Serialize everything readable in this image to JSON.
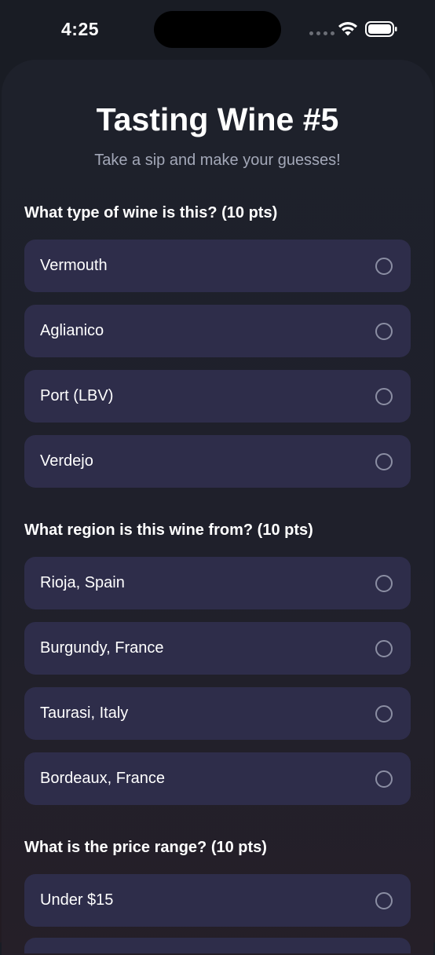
{
  "status": {
    "time": "4:25"
  },
  "header": {
    "title": "Tasting Wine #5",
    "subtitle": "Take a sip and make your guesses!"
  },
  "questions": [
    {
      "text": "What type of wine is this? (10 pts)",
      "options": [
        "Vermouth",
        "Aglianico",
        "Port (LBV)",
        "Verdejo"
      ]
    },
    {
      "text": "What region is this wine from? (10 pts)",
      "options": [
        "Rioja, Spain",
        "Burgundy, France",
        "Taurasi, Italy",
        "Bordeaux, France"
      ]
    },
    {
      "text": "What is the price range? (10 pts)",
      "options": [
        "Under $15"
      ]
    }
  ],
  "colors": {
    "background": "#1e212b",
    "option_background": "#2e2d4a",
    "radio_border": "#8b8ea3",
    "subtitle": "#a3a8b8"
  },
  "icons": {
    "wifi": "wifi-icon",
    "battery": "battery-icon",
    "signal": "cellular-signal-icon",
    "radio": "radio-unselected-icon"
  }
}
